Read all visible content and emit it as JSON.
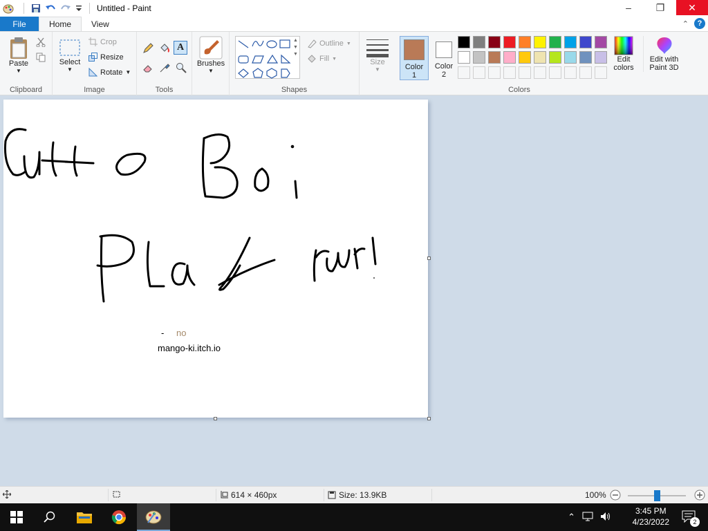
{
  "window": {
    "title": "Untitled - Paint"
  },
  "tabs": {
    "file": "File",
    "home": "Home",
    "view": "View"
  },
  "ribbon": {
    "clipboard": {
      "paste": "Paste",
      "label": "Clipboard"
    },
    "image": {
      "select": "Select",
      "crop": "Crop",
      "resize": "Resize",
      "rotate": "Rotate",
      "label": "Image"
    },
    "tools": {
      "label": "Tools"
    },
    "brushes": {
      "label": "Brushes"
    },
    "shapes": {
      "outline": "Outline",
      "fill": "Fill",
      "label": "Shapes"
    },
    "size": {
      "label": "Size"
    },
    "colors": {
      "color1": "Color\n1",
      "color1_top": "Color",
      "color1_bottom": "1",
      "color2_top": "Color",
      "color2_bottom": "2",
      "edit_colors_top": "Edit",
      "edit_colors_bottom": "colors",
      "paint3d_top": "Edit with",
      "paint3d_bottom": "Paint 3D",
      "label": "Colors",
      "color1_value": "#b97a57",
      "color2_value": "#ffffff",
      "palette_row1": [
        "#000000",
        "#7f7f7f",
        "#880015",
        "#ed1c24",
        "#ff7f27",
        "#fff200",
        "#22b14c",
        "#00a2e8",
        "#3f48cc",
        "#a349a4"
      ],
      "palette_row2": [
        "#ffffff",
        "#c3c3c3",
        "#b97a57",
        "#ffaec9",
        "#ffc90e",
        "#efe4b0",
        "#b5e61d",
        "#99d9ea",
        "#7092be",
        "#c8bfe7"
      ]
    }
  },
  "canvas": {
    "dash_text": "-",
    "no_text": "no",
    "url_text": "mango-ki.itch.io"
  },
  "status": {
    "dimensions": "614 × 460px",
    "size": "Size: 13.9KB",
    "zoom": "100%",
    "zoom_level": 0.5
  },
  "taskbar": {
    "time": "3:45 PM",
    "date": "4/23/2022",
    "notifications": "2"
  }
}
